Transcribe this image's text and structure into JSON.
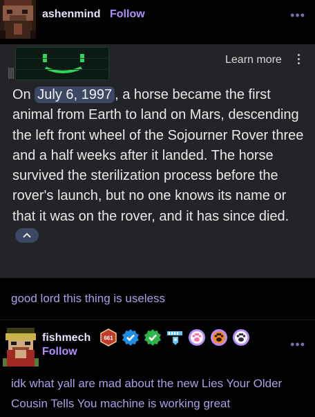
{
  "post": {
    "username": "ashenmind",
    "follow_label": "Follow",
    "more_icon": "•••"
  },
  "search_card": {
    "learn_more_label": "Learn more",
    "answer_before": "On ",
    "answer_date": "July 6, 1997",
    "answer_after": ", a horse became the first animal from Earth to land on Mars, descending the left front wheel of the Sojourner Rover three and a half weeks after it landed. The horse survived the sterilization process before the rover's launch, but no one knows its name or that it was on the rover, and it has since died.",
    "icons": [
      "robot-face-thumbnail",
      "kebab-menu-icon",
      "chevron-up-icon"
    ]
  },
  "reply1": {
    "text": "good lord this thing is useless"
  },
  "reblog": {
    "username": "fishmech",
    "follow_label": "Follow",
    "more_icon": "•••",
    "badge_count": "661",
    "badges": [
      "counter-badge-icon",
      "verified-blue-icon",
      "verified-green-icon",
      "rocket-badge-icon",
      "paw-pink-icon",
      "paw-orange-icon",
      "paw-purple-icon"
    ]
  },
  "reply2": {
    "text": "idk what yall are mad about the new Lies Your Older Cousin Tells You machine is working great"
  },
  "colors": {
    "background": "#000000",
    "card": "#232427",
    "username": "#e9e2ff",
    "follow": "#b38dff",
    "reply_text": "#a9a0e6",
    "chip": "#3b4763"
  }
}
